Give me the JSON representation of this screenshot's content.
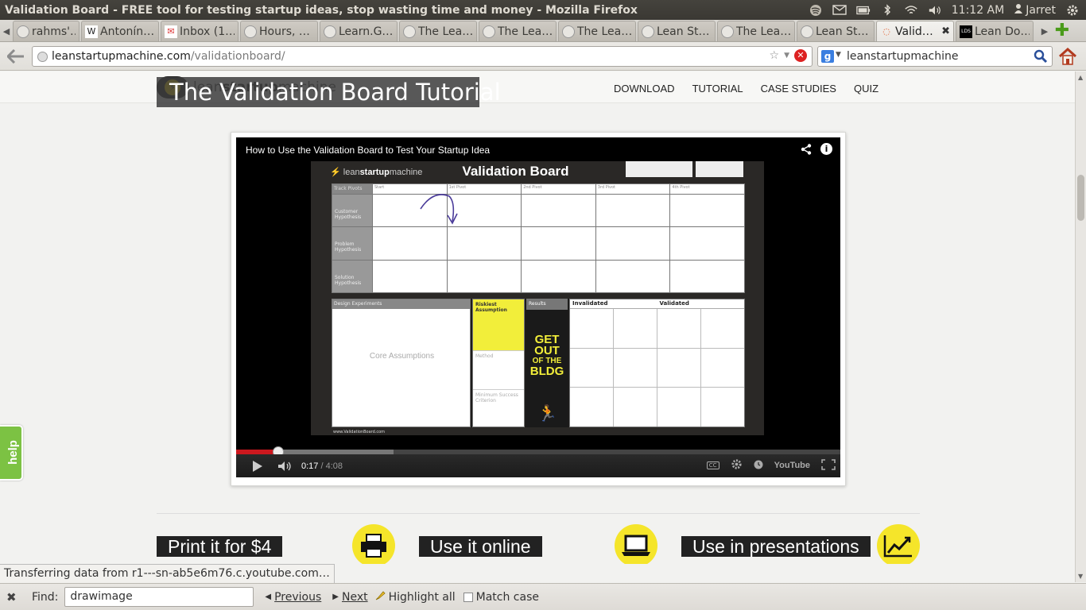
{
  "window": {
    "title": "Validation Board - FREE tool for testing startup ideas, stop wasting time and money - Mozilla Firefox",
    "clock": "11:12 AM",
    "user": "Jarret"
  },
  "tabs": [
    {
      "label": "rahms'…",
      "icon": "page-icon"
    },
    {
      "label": "Antonín…",
      "icon": "wikipedia-icon"
    },
    {
      "label": "Inbox (1…",
      "icon": "gmail-icon"
    },
    {
      "label": "Hours, …",
      "icon": "page-icon"
    },
    {
      "label": "Learn.G…",
      "icon": "page-icon"
    },
    {
      "label": "The Lea…",
      "icon": "page-icon"
    },
    {
      "label": "The Lea…",
      "icon": "page-icon"
    },
    {
      "label": "The Lea…",
      "icon": "page-icon"
    },
    {
      "label": "Lean St…",
      "icon": "page-icon"
    },
    {
      "label": "The Lea…",
      "icon": "page-icon"
    },
    {
      "label": "Lean St…",
      "icon": "page-icon"
    },
    {
      "label": "Valid…",
      "icon": "loading-icon",
      "active": true
    },
    {
      "label": "Lean Do…",
      "icon": "lds-icon"
    }
  ],
  "nav": {
    "url_host": "leanstartupmachine.com",
    "url_path": "/validationboard/",
    "search_value": "leanstartupmachine"
  },
  "site": {
    "logo_prefix": "lean",
    "logo_bold": "startup",
    "logo_suffix": "machine",
    "tutorial_title": "The Validation Board Tutorial",
    "menu": [
      "DOWNLOAD",
      "TUTORIAL",
      "CASE STUDIES",
      "QUIZ"
    ]
  },
  "video": {
    "title": "How to Use the Validation Board to Test Your Startup Idea",
    "current_time": "0:17",
    "duration": "/ 4:08",
    "played_fraction": 0.07,
    "buffered_fraction": 0.26,
    "youtube_label": "YouTube",
    "board": {
      "logo_text_light": "lean",
      "logo_text_bold": "startup",
      "logo_text_end": "machine",
      "title": "Validation Board",
      "track_pivots": "Track Pivots",
      "columns": [
        "Start",
        "1st Pivot",
        "2nd Pivot",
        "3rd Pivot",
        "4th Pivot"
      ],
      "rows": [
        "Customer Hypothesis",
        "Problem Hypothesis",
        "Solution Hypothesis"
      ],
      "design_experiments": "Design Experiments",
      "core_assumptions": "Core Assumptions",
      "riskiest_assumption": "Riskiest Assumption",
      "method": "Method",
      "minimum_success": "Minimum Success Criterion",
      "results": "Results",
      "get_out_1": "GET",
      "get_out_2": "OUT",
      "get_out_3": "OF THE",
      "get_out_4": "BLDG",
      "invalidated": "Invalidated",
      "validated": "Validated",
      "footer": "www.ValidationBoard.com"
    }
  },
  "cta": {
    "print": "Print it for $4",
    "online": "Use it online",
    "presentations": "Use in presentations"
  },
  "help_label": "help",
  "status_text": "Transferring data from r1---sn-ab5e6m76.c.youtube.com…",
  "findbar": {
    "label": "Find:",
    "value": "drawimage",
    "previous": "Previous",
    "next": "Next",
    "highlight": "Highlight all",
    "match_case": "Match case"
  }
}
